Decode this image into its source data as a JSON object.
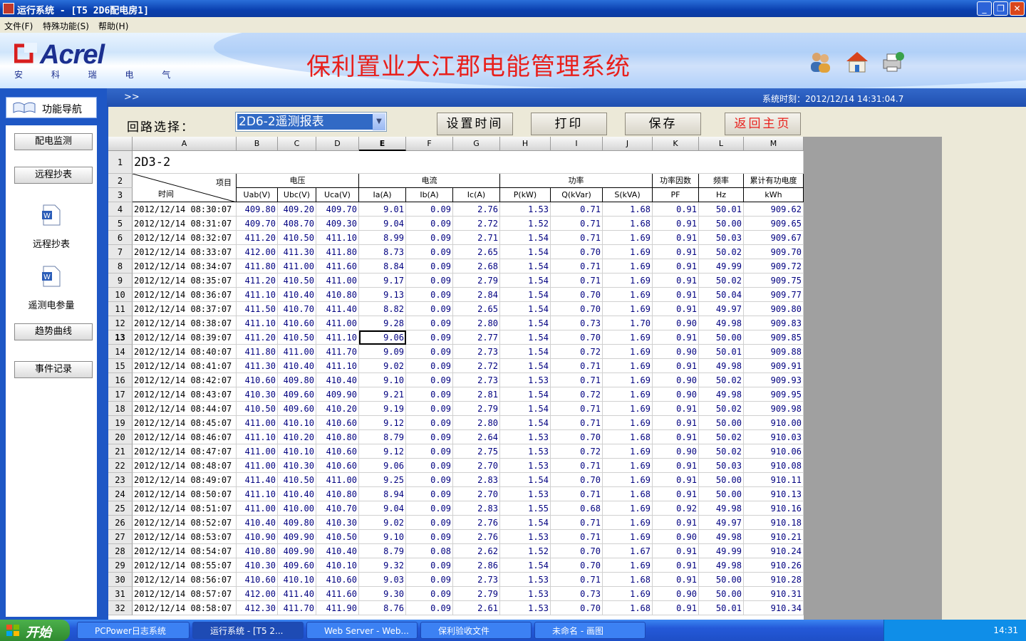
{
  "window": {
    "title": "运行系统 - [T5 2D6配电房1]"
  },
  "menu": [
    "文件(F)",
    "特殊功能(S)",
    "帮助(H)"
  ],
  "banner": {
    "brand": "Acrel",
    "brand_cn": "安 科 瑞 电 气",
    "system_title": "保利置业大江郡电能管理系统"
  },
  "nav": {
    "header": "功能导航",
    "items": [
      "配电监测",
      "远程抄表",
      "远程抄表",
      "遥测电参量",
      "趋势曲线",
      "事件记录"
    ]
  },
  "header": {
    "arrows": ">>",
    "clock": "系统时刻：2012/12/14  14:31:04.7"
  },
  "toolbar": {
    "circuit_label": "回路选择：",
    "circuit_value": "2D6-2遥测报表",
    "set_time": "设置时间",
    "print": "打印",
    "save": "保存",
    "home": "返回主页"
  },
  "sheet": {
    "columns": [
      "A",
      "B",
      "C",
      "D",
      "E",
      "F",
      "G",
      "H",
      "I",
      "J",
      "K",
      "L",
      "M"
    ],
    "title": "2D3-2",
    "hdr_item": "项目",
    "hdr_time": "时间",
    "groups": [
      "电压",
      "电流",
      "功率",
      "功率因数",
      "频率",
      "累计有功电度"
    ],
    "units": [
      "Uab(V)",
      "Ubc(V)",
      "Uca(V)",
      "Ia(A)",
      "Ib(A)",
      "Ic(A)",
      "P(kW)",
      "Q(kVar)",
      "S(kVA)",
      "PF",
      "Hz",
      "kWh"
    ],
    "rows": [
      [
        "2012/12/14 08:30:07",
        "409.80",
        "409.20",
        "409.70",
        "9.01",
        "0.09",
        "2.76",
        "1.53",
        "0.71",
        "1.68",
        "0.91",
        "50.01",
        "909.62"
      ],
      [
        "2012/12/14 08:31:07",
        "409.70",
        "408.70",
        "409.30",
        "9.04",
        "0.09",
        "2.72",
        "1.52",
        "0.71",
        "1.68",
        "0.91",
        "50.00",
        "909.65"
      ],
      [
        "2012/12/14 08:32:07",
        "411.20",
        "410.50",
        "411.10",
        "8.99",
        "0.09",
        "2.71",
        "1.54",
        "0.71",
        "1.69",
        "0.91",
        "50.03",
        "909.67"
      ],
      [
        "2012/12/14 08:33:07",
        "412.00",
        "411.30",
        "411.80",
        "8.73",
        "0.09",
        "2.65",
        "1.54",
        "0.70",
        "1.69",
        "0.91",
        "50.02",
        "909.70"
      ],
      [
        "2012/12/14 08:34:07",
        "411.80",
        "411.00",
        "411.60",
        "8.84",
        "0.09",
        "2.68",
        "1.54",
        "0.71",
        "1.69",
        "0.91",
        "49.99",
        "909.72"
      ],
      [
        "2012/12/14 08:35:07",
        "411.20",
        "410.50",
        "411.00",
        "9.17",
        "0.09",
        "2.79",
        "1.54",
        "0.71",
        "1.69",
        "0.91",
        "50.02",
        "909.75"
      ],
      [
        "2012/12/14 08:36:07",
        "411.10",
        "410.40",
        "410.80",
        "9.13",
        "0.09",
        "2.84",
        "1.54",
        "0.70",
        "1.69",
        "0.91",
        "50.04",
        "909.77"
      ],
      [
        "2012/12/14 08:37:07",
        "411.50",
        "410.70",
        "411.40",
        "8.82",
        "0.09",
        "2.65",
        "1.54",
        "0.70",
        "1.69",
        "0.91",
        "49.97",
        "909.80"
      ],
      [
        "2012/12/14 08:38:07",
        "411.10",
        "410.60",
        "411.00",
        "9.28",
        "0.09",
        "2.80",
        "1.54",
        "0.73",
        "1.70",
        "0.90",
        "49.98",
        "909.83"
      ],
      [
        "2012/12/14 08:39:07",
        "411.20",
        "410.50",
        "411.10",
        "9.06",
        "0.09",
        "2.77",
        "1.54",
        "0.70",
        "1.69",
        "0.91",
        "50.00",
        "909.85"
      ],
      [
        "2012/12/14 08:40:07",
        "411.80",
        "411.00",
        "411.70",
        "9.09",
        "0.09",
        "2.73",
        "1.54",
        "0.72",
        "1.69",
        "0.90",
        "50.01",
        "909.88"
      ],
      [
        "2012/12/14 08:41:07",
        "411.30",
        "410.40",
        "411.10",
        "9.02",
        "0.09",
        "2.72",
        "1.54",
        "0.71",
        "1.69",
        "0.91",
        "49.98",
        "909.91"
      ],
      [
        "2012/12/14 08:42:07",
        "410.60",
        "409.80",
        "410.40",
        "9.10",
        "0.09",
        "2.73",
        "1.53",
        "0.71",
        "1.69",
        "0.90",
        "50.02",
        "909.93"
      ],
      [
        "2012/12/14 08:43:07",
        "410.30",
        "409.60",
        "409.90",
        "9.21",
        "0.09",
        "2.81",
        "1.54",
        "0.72",
        "1.69",
        "0.90",
        "49.98",
        "909.95"
      ],
      [
        "2012/12/14 08:44:07",
        "410.50",
        "409.60",
        "410.20",
        "9.19",
        "0.09",
        "2.79",
        "1.54",
        "0.71",
        "1.69",
        "0.91",
        "50.02",
        "909.98"
      ],
      [
        "2012/12/14 08:45:07",
        "411.00",
        "410.10",
        "410.60",
        "9.12",
        "0.09",
        "2.80",
        "1.54",
        "0.71",
        "1.69",
        "0.91",
        "50.00",
        "910.00"
      ],
      [
        "2012/12/14 08:46:07",
        "411.10",
        "410.20",
        "410.80",
        "8.79",
        "0.09",
        "2.64",
        "1.53",
        "0.70",
        "1.68",
        "0.91",
        "50.02",
        "910.03"
      ],
      [
        "2012/12/14 08:47:07",
        "411.00",
        "410.10",
        "410.60",
        "9.12",
        "0.09",
        "2.75",
        "1.53",
        "0.72",
        "1.69",
        "0.90",
        "50.02",
        "910.06"
      ],
      [
        "2012/12/14 08:48:07",
        "411.00",
        "410.30",
        "410.60",
        "9.06",
        "0.09",
        "2.70",
        "1.53",
        "0.71",
        "1.69",
        "0.91",
        "50.03",
        "910.08"
      ],
      [
        "2012/12/14 08:49:07",
        "411.40",
        "410.50",
        "411.00",
        "9.25",
        "0.09",
        "2.83",
        "1.54",
        "0.70",
        "1.69",
        "0.91",
        "50.00",
        "910.11"
      ],
      [
        "2012/12/14 08:50:07",
        "411.10",
        "410.40",
        "410.80",
        "8.94",
        "0.09",
        "2.70",
        "1.53",
        "0.71",
        "1.68",
        "0.91",
        "50.00",
        "910.13"
      ],
      [
        "2012/12/14 08:51:07",
        "411.00",
        "410.00",
        "410.70",
        "9.04",
        "0.09",
        "2.83",
        "1.55",
        "0.68",
        "1.69",
        "0.92",
        "49.98",
        "910.16"
      ],
      [
        "2012/12/14 08:52:07",
        "410.40",
        "409.80",
        "410.30",
        "9.02",
        "0.09",
        "2.76",
        "1.54",
        "0.71",
        "1.69",
        "0.91",
        "49.97",
        "910.18"
      ],
      [
        "2012/12/14 08:53:07",
        "410.90",
        "409.90",
        "410.50",
        "9.10",
        "0.09",
        "2.76",
        "1.53",
        "0.71",
        "1.69",
        "0.90",
        "49.98",
        "910.21"
      ],
      [
        "2012/12/14 08:54:07",
        "410.80",
        "409.90",
        "410.40",
        "8.79",
        "0.08",
        "2.62",
        "1.52",
        "0.70",
        "1.67",
        "0.91",
        "49.99",
        "910.24"
      ],
      [
        "2012/12/14 08:55:07",
        "410.30",
        "409.60",
        "410.10",
        "9.32",
        "0.09",
        "2.86",
        "1.54",
        "0.70",
        "1.69",
        "0.91",
        "49.98",
        "910.26"
      ],
      [
        "2012/12/14 08:56:07",
        "410.60",
        "410.10",
        "410.60",
        "9.03",
        "0.09",
        "2.73",
        "1.53",
        "0.71",
        "1.68",
        "0.91",
        "50.00",
        "910.28"
      ],
      [
        "2012/12/14 08:57:07",
        "412.00",
        "411.40",
        "411.60",
        "9.30",
        "0.09",
        "2.79",
        "1.53",
        "0.73",
        "1.69",
        "0.90",
        "50.00",
        "910.31"
      ],
      [
        "2012/12/14 08:58:07",
        "412.30",
        "411.70",
        "411.90",
        "8.76",
        "0.09",
        "2.61",
        "1.53",
        "0.70",
        "1.68",
        "0.91",
        "50.01",
        "910.34"
      ]
    ]
  },
  "taskbar": {
    "start": "开始",
    "tasks": [
      "PCPower日志系统",
      "运行系统 - [T5 2...",
      "Web Server - Web...",
      "保利验收文件",
      "未命名 - 画图"
    ],
    "time": "14:31"
  }
}
